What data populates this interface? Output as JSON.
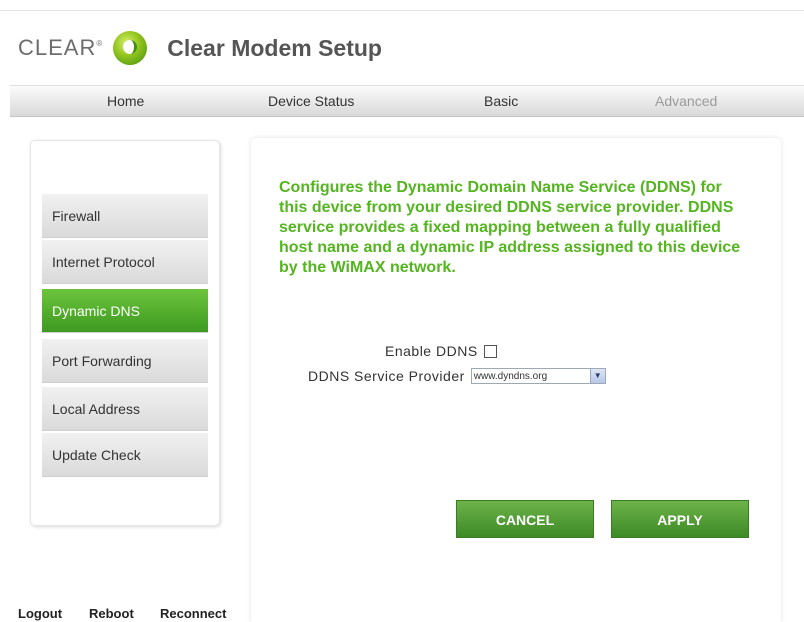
{
  "header": {
    "brand_word": "CLEAR",
    "brand_mark": "®",
    "title": "Clear Modem Setup"
  },
  "nav": {
    "items": [
      "Home",
      "Device Status",
      "Basic",
      "Advanced"
    ]
  },
  "sidebar": {
    "items": [
      "Firewall",
      "Internet Protocol",
      "Dynamic DNS",
      "Port Forwarding",
      "Local Address",
      "Update Check"
    ],
    "active": "Dynamic DNS"
  },
  "main": {
    "description": "Configures the Dynamic Domain Name Service (DDNS) for this device from your desired DDNS service provider. DDNS service provides a fixed mapping between a fully qualified host name and a dynamic IP address assigned to this device by the WiMAX network.",
    "enable_label": "Enable DDNS",
    "enable_checked": false,
    "provider_label": "DDNS Service Provider",
    "provider_value": "www.dyndns.org",
    "cancel_label": "CANCEL",
    "apply_label": "APPLY"
  },
  "footer": {
    "logout": "Logout",
    "reboot": "Reboot",
    "reconnect": "Reconnect"
  },
  "colors": {
    "accent_green": "#55b521",
    "button_green": "#4f9e33"
  },
  "icons": {
    "logo": "clear-swirl-logo-icon",
    "dropdown": "chevron-down-icon"
  }
}
